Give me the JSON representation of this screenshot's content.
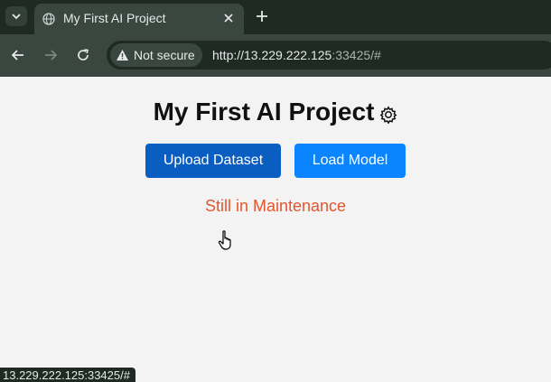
{
  "browser": {
    "tab": {
      "title": "My First AI Project",
      "favicon": "globe-icon"
    },
    "omnibox": {
      "security_label": "Not secure",
      "url_host": "http://13.229.222.125",
      "url_rest": ":33425/#"
    },
    "status_url": "13.229.222.125:33425/#"
  },
  "page": {
    "title": "My First AI Project",
    "title_icon": "gear-icon",
    "buttons": {
      "upload": "Upload Dataset",
      "load": "Load Model"
    },
    "notice": "Still in Maintenance"
  },
  "colors": {
    "upload_button": "#0a5ec2",
    "load_button": "#0a84ff",
    "notice_text": "#e4562d",
    "chrome_dark": "#1f2a24",
    "chrome_mid": "#3a4741"
  }
}
